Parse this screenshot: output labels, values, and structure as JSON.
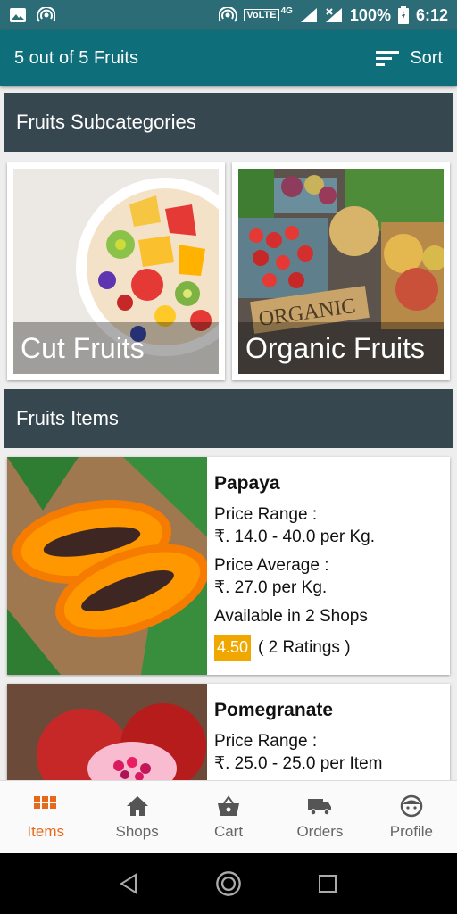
{
  "status_bar": {
    "battery": "100%",
    "time": "6:12",
    "network": "VoLTE",
    "network_type": "4G",
    "icons": [
      "image-icon",
      "hotspot-icon",
      "hotspot-icon",
      "signal-icon",
      "signal-icon",
      "battery-icon"
    ]
  },
  "app_bar": {
    "title": "5 out of 5 Fruits",
    "sort_label": "Sort"
  },
  "subcategories": {
    "header": "Fruits Subcategories",
    "items": [
      {
        "label": "Cut Fruits"
      },
      {
        "label": "Organic Fruits",
        "sign_text": "ORGANIC"
      }
    ]
  },
  "items_section": {
    "header": "Fruits Items",
    "items": [
      {
        "name": "Papaya",
        "price_range_label": "Price Range :",
        "price_range": "₹. 14.0 - 40.0 per Kg.",
        "price_average_label": "Price Average :",
        "price_average": "₹. 27.0 per Kg.",
        "availability": "Available in 2 Shops",
        "rating": "4.50",
        "ratings_count": "( 2 Ratings )"
      },
      {
        "name": "Pomegranate",
        "price_range_label": "Price Range :",
        "price_range": "₹. 25.0 - 25.0 per Item"
      }
    ]
  },
  "bottom_nav": [
    {
      "label": "Items",
      "icon": "grid-icon",
      "active": true
    },
    {
      "label": "Shops",
      "icon": "home-icon",
      "active": false
    },
    {
      "label": "Cart",
      "icon": "basket-icon",
      "active": false
    },
    {
      "label": "Orders",
      "icon": "truck-icon",
      "active": false
    },
    {
      "label": "Profile",
      "icon": "face-icon",
      "active": false
    }
  ],
  "colors": {
    "app_bar": "#0e6e79",
    "section_header": "#37474f",
    "accent": "#e8681a",
    "rating_badge": "#f0a800"
  }
}
